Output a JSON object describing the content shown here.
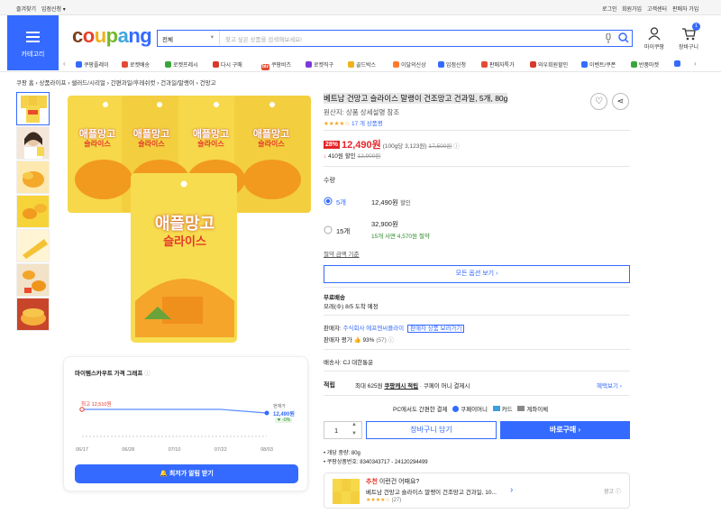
{
  "topbar": {
    "bookmark": "즐겨찾기",
    "partner": "입점신청",
    "login": "로그인",
    "signup": "회원가입",
    "cs": "고객센터",
    "seller_signup": "판매자 가입"
  },
  "category_label": "카테고리",
  "logo": "coupang",
  "search": {
    "select": "전체",
    "placeholder": "찾고 싶은 상품을 검색해보세요!"
  },
  "header": {
    "mycoupang": "마이쿠팡",
    "cart": "장바구니",
    "cart_count": "1"
  },
  "nav": [
    "쿠팡플레이",
    "로켓배송",
    "로켓프레시",
    "다시 구매",
    "쿠팡비즈",
    "로켓직구",
    "골드박스",
    "이달의신상",
    "입점신청",
    "판매자특가",
    "와우회원할인",
    "이벤트/쿠폰",
    "반품마켓"
  ],
  "nav_badges": {
    "biz": "biz"
  },
  "breadcrumb": [
    "쿠팡 홈",
    "상품라이프",
    "샐러드/시리얼",
    "간편과일/후레쉬컷",
    "건과일/말랭이",
    "건망고"
  ],
  "product_pkg": {
    "line1": "애플망고",
    "line2": "슬라이스"
  },
  "product": {
    "title": "베트남 건망고 슬라이스 말랭이 건조망고 건과일, 5개, 80g",
    "origin": "원산지: 상품 상세설명 참조",
    "stars": "★★★★☆",
    "review_count": "17 개 상품평",
    "discount": "28%",
    "price": "12,490원",
    "unit_price": "(100g당 3,123원)",
    "orig_price": "17,500원",
    "sale_text": "410원 할인",
    "sale_orig": "12,900원",
    "qty_label": "수량",
    "option1_qty": "5개",
    "option1_price": "12,490원",
    "option1_tag": "할인",
    "option2_qty": "15개",
    "option2_price": "32,900원",
    "option2_note": "15개 사면 4,570원 절약",
    "discount_criteria": "절약 금액 기준",
    "all_options": "모든 옵션 보기 ›",
    "free_ship": "무료배송",
    "delivery": "모레(수) 8/5 도착 예정",
    "seller_label": "판매자:",
    "seller_name": "주식회사 에프엔씨플라이",
    "seller_more": "판매자 상품 보러가기",
    "rating_label": "판매자 평가",
    "rating_val": "93%",
    "rating_count": "(57)",
    "shipper": "배송사: CJ 대한통운",
    "earn_label": "적립",
    "earn_text": "최대 625원",
    "earn_link": "쿠팡캐시 적립",
    "earn_tail": "· 쿠페이 머니 결제시",
    "benefit": "혜택보기 ›",
    "pay_text": "PC에서도 간편한 결제",
    "pay_opt1": "쿠페이머니",
    "pay_opt2": "카드",
    "pay_opt3": "계좌이체",
    "qty_value": "1",
    "cart_btn": "장바구니 담기",
    "buy_btn": "바로구매 ›",
    "spec1": "개당 중량: 80g",
    "spec2": "쿠팡상품번호: 8340343717 - 24120294499"
  },
  "rec": {
    "label": "추천",
    "title": "이런건 어때요?",
    "name": "베트남 건망고 슬라이스 말랭이 건조망고 건과일, 10...",
    "stars": "★★★★☆",
    "count": "(27)",
    "ad": "광고"
  },
  "price_chart": {
    "title": "마이템스카우트 가격 그래프",
    "max_label": "최고 12,510원",
    "cur_label": "현재가",
    "cur_price": "12,490원",
    "change": "▼ -0%",
    "cta": "최저가 알림 받기"
  },
  "chart_data": {
    "type": "line",
    "x": [
      "06/17",
      "06/28",
      "07/10",
      "07/22",
      "08/03"
    ],
    "values": [
      12510,
      12510,
      12510,
      12510,
      12490
    ],
    "xlabel": "",
    "ylabel": ""
  }
}
